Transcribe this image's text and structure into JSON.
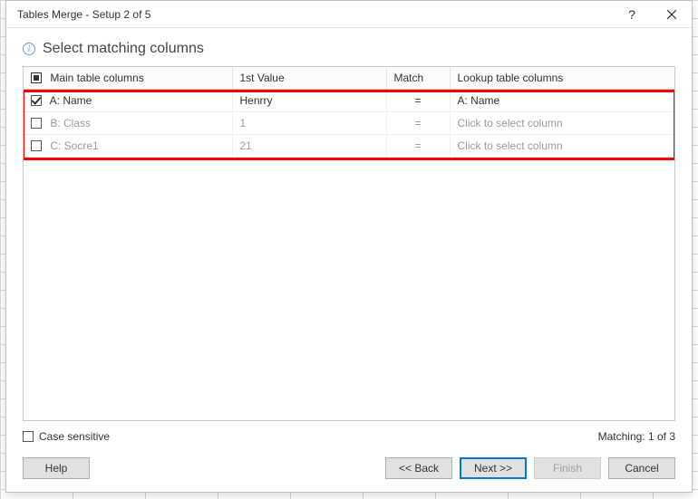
{
  "window": {
    "title": "Tables Merge - Setup 2 of 5"
  },
  "header": {
    "heading": "Select matching columns"
  },
  "table": {
    "headers": {
      "main": "Main table columns",
      "first_value": "1st Value",
      "match": "Match",
      "lookup": "Lookup table columns"
    },
    "rows": [
      {
        "checked": true,
        "main": "A: Name",
        "value": "Henrry",
        "match": "=",
        "lookup": "A: Name",
        "lookup_placeholder": false
      },
      {
        "checked": false,
        "main": "B: Class",
        "value": "1",
        "match": "=",
        "lookup": "Click to select column",
        "lookup_placeholder": true
      },
      {
        "checked": false,
        "main": "C: Socre1",
        "value": "21",
        "match": "=",
        "lookup": "Click to select column",
        "lookup_placeholder": true
      }
    ]
  },
  "options": {
    "case_sensitive_label": "Case sensitive",
    "case_sensitive_checked": false
  },
  "status": {
    "matching": "Matching: 1 of 3"
  },
  "buttons": {
    "help": "Help",
    "back": "<< Back",
    "next": "Next >>",
    "finish": "Finish",
    "cancel": "Cancel"
  }
}
